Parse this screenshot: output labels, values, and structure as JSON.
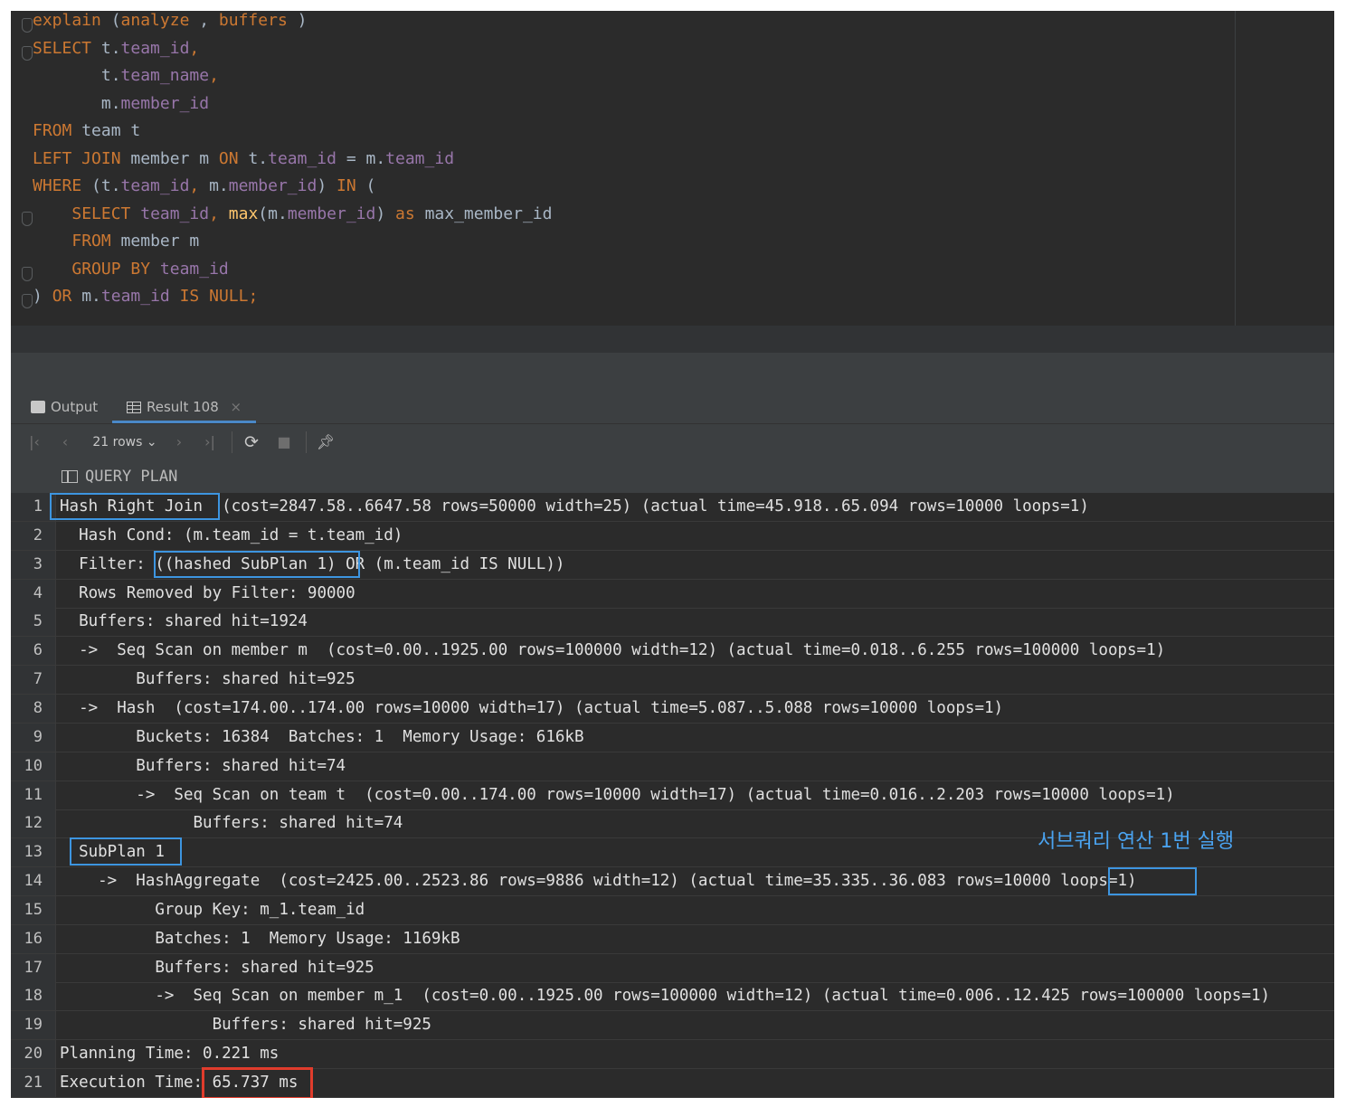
{
  "editor": {
    "lines": [
      [
        [
          "kw",
          "explain"
        ],
        [
          "txt",
          " ("
        ],
        [
          "kw",
          "analyze"
        ],
        [
          "txt",
          " , "
        ],
        [
          "kw",
          "buffers"
        ],
        [
          "txt",
          " )"
        ]
      ],
      [
        [
          "kw",
          "SELECT"
        ],
        [
          "txt",
          " t."
        ],
        [
          "fld",
          "team_id"
        ],
        [
          "kw",
          ","
        ]
      ],
      [
        [
          "txt",
          "       t."
        ],
        [
          "fld",
          "team_name"
        ],
        [
          "kw",
          ","
        ]
      ],
      [
        [
          "txt",
          "       m."
        ],
        [
          "fld",
          "member_id"
        ]
      ],
      [
        [
          "kw",
          "FROM"
        ],
        [
          "txt",
          " team t"
        ]
      ],
      [
        [
          "kw",
          "LEFT JOIN"
        ],
        [
          "txt",
          " member m "
        ],
        [
          "kw",
          "ON"
        ],
        [
          "txt",
          " t."
        ],
        [
          "fld",
          "team_id"
        ],
        [
          "txt",
          " = m."
        ],
        [
          "fld",
          "team_id"
        ]
      ],
      [
        [
          "kw",
          "WHERE"
        ],
        [
          "txt",
          " (t."
        ],
        [
          "fld",
          "team_id"
        ],
        [
          "kw",
          ","
        ],
        [
          "txt",
          " m."
        ],
        [
          "fld",
          "member_id"
        ],
        [
          "txt",
          ") "
        ],
        [
          "kw",
          "IN"
        ],
        [
          "txt",
          " ("
        ]
      ],
      [
        [
          "txt",
          "    "
        ],
        [
          "kw",
          "SELECT"
        ],
        [
          "txt",
          " "
        ],
        [
          "fld",
          "team_id"
        ],
        [
          "kw",
          ","
        ],
        [
          "txt",
          " "
        ],
        [
          "fn",
          "max"
        ],
        [
          "txt",
          "(m."
        ],
        [
          "fld",
          "member_id"
        ],
        [
          "txt",
          ") "
        ],
        [
          "kw",
          "as"
        ],
        [
          "txt",
          " max_member_id"
        ]
      ],
      [
        [
          "txt",
          "    "
        ],
        [
          "kw",
          "FROM"
        ],
        [
          "txt",
          " member m"
        ]
      ],
      [
        [
          "txt",
          "    "
        ],
        [
          "kw",
          "GROUP BY"
        ],
        [
          "txt",
          " "
        ],
        [
          "fld",
          "team_id"
        ]
      ],
      [
        [
          "txt",
          ") "
        ],
        [
          "kw",
          "OR"
        ],
        [
          "txt",
          " m."
        ],
        [
          "fld",
          "team_id"
        ],
        [
          "txt",
          " "
        ],
        [
          "kw",
          "IS NULL;"
        ]
      ]
    ]
  },
  "tabs": {
    "output": "Output",
    "result": "Result 108",
    "close": "×"
  },
  "toolbar": {
    "rows": "21 rows"
  },
  "grid": {
    "column": "QUERY PLAN",
    "rows": [
      {
        "n": "1",
        "text": "Hash Right Join  (cost=2847.58..6647.58 rows=50000 width=25) (actual time=45.918..65.094 rows=10000 loops=1)"
      },
      {
        "n": "2",
        "text": "  Hash Cond: (m.team_id = t.team_id)"
      },
      {
        "n": "3",
        "text": "  Filter: ((hashed SubPlan 1) OR (m.team_id IS NULL))"
      },
      {
        "n": "4",
        "text": "  Rows Removed by Filter: 90000"
      },
      {
        "n": "5",
        "text": "  Buffers: shared hit=1924"
      },
      {
        "n": "6",
        "text": "  ->  Seq Scan on member m  (cost=0.00..1925.00 rows=100000 width=12) (actual time=0.018..6.255 rows=100000 loops=1)"
      },
      {
        "n": "7",
        "text": "        Buffers: shared hit=925"
      },
      {
        "n": "8",
        "text": "  ->  Hash  (cost=174.00..174.00 rows=10000 width=17) (actual time=5.087..5.088 rows=10000 loops=1)"
      },
      {
        "n": "9",
        "text": "        Buckets: 16384  Batches: 1  Memory Usage: 616kB"
      },
      {
        "n": "10",
        "text": "        Buffers: shared hit=74"
      },
      {
        "n": "11",
        "text": "        ->  Seq Scan on team t  (cost=0.00..174.00 rows=10000 width=17) (actual time=0.016..2.203 rows=10000 loops=1)"
      },
      {
        "n": "12",
        "text": "              Buffers: shared hit=74"
      },
      {
        "n": "13",
        "text": "  SubPlan 1"
      },
      {
        "n": "14",
        "text": "    ->  HashAggregate  (cost=2425.00..2523.86 rows=9886 width=12) (actual time=35.335..36.083 rows=10000 loops=1)"
      },
      {
        "n": "15",
        "text": "          Group Key: m_1.team_id"
      },
      {
        "n": "16",
        "text": "          Batches: 1  Memory Usage: 1169kB"
      },
      {
        "n": "17",
        "text": "          Buffers: shared hit=925"
      },
      {
        "n": "18",
        "text": "          ->  Seq Scan on member m_1  (cost=0.00..1925.00 rows=100000 width=12) (actual time=0.006..12.425 rows=100000 loops=1)"
      },
      {
        "n": "19",
        "text": "                Buffers: shared hit=925"
      },
      {
        "n": "20",
        "text": "Planning Time: 0.221 ms"
      },
      {
        "n": "21",
        "text": "Execution Time: 65.737 ms"
      }
    ]
  },
  "annotation": {
    "note": "서브쿼리 연산 1번 실행"
  }
}
